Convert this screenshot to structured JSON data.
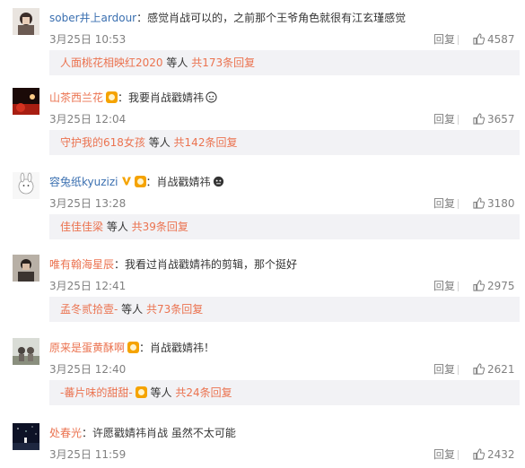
{
  "comments": [
    {
      "username": "sober井上ardour",
      "separator": "：",
      "text": "感觉肖战可以的，之前那个王爷角色就很有江玄瑾感觉",
      "time": "3月25日 10:53",
      "reply_label": "回复",
      "likes": "4587",
      "replies": {
        "user": "人面桃花相映红2020",
        "mid": " 等人 ",
        "count": "共173条回复"
      }
    },
    {
      "username": "山茶西兰花",
      "separator": "：",
      "text": "我要肖战戳婧祎",
      "time": "3月25日 12:04",
      "reply_label": "回复",
      "likes": "3657",
      "replies": {
        "user": "守护我的618女孩",
        "mid": " 等人 ",
        "count": "共142条回复"
      }
    },
    {
      "username": "容兔纸kyuzizi",
      "separator": "：",
      "text": "肖战戳婧祎",
      "time": "3月25日 13:28",
      "reply_label": "回复",
      "likes": "3180",
      "replies": {
        "user": "佳佳佳梁",
        "mid": " 等人 ",
        "count": "共39条回复"
      }
    },
    {
      "username": "唯有翰海星辰",
      "separator": "：",
      "text": "我看过肖战戳婧祎的剪辑，那个挺好",
      "time": "3月25日 12:41",
      "reply_label": "回复",
      "likes": "2975",
      "replies": {
        "user": "孟冬贰拾壹-",
        "mid": " 等人 ",
        "count": "共73条回复"
      }
    },
    {
      "username": "原来是蛋黄酥啊",
      "separator": "：",
      "text": "肖战戳婧祎！",
      "time": "3月25日 12:40",
      "reply_label": "回复",
      "likes": "2621",
      "replies": {
        "user": "-蕃片味的甜甜-",
        "mid": " 等人 ",
        "count": "共24条回复"
      }
    },
    {
      "username": "处春光",
      "separator": "：",
      "text": "许愿戳婧祎肖战 虽然不太可能",
      "time": "3月25日 11:59",
      "reply_label": "回复",
      "likes": "2432"
    }
  ],
  "colors": {
    "username": "#eb7350",
    "username_alt": "#3a6fb0",
    "meta": "#808080",
    "subbox_bg": "#f2f2f5"
  },
  "icons": [
    "avatar",
    "member-badge-icon",
    "vip-v-icon",
    "emoji-icon",
    "thumbs-up-icon"
  ]
}
